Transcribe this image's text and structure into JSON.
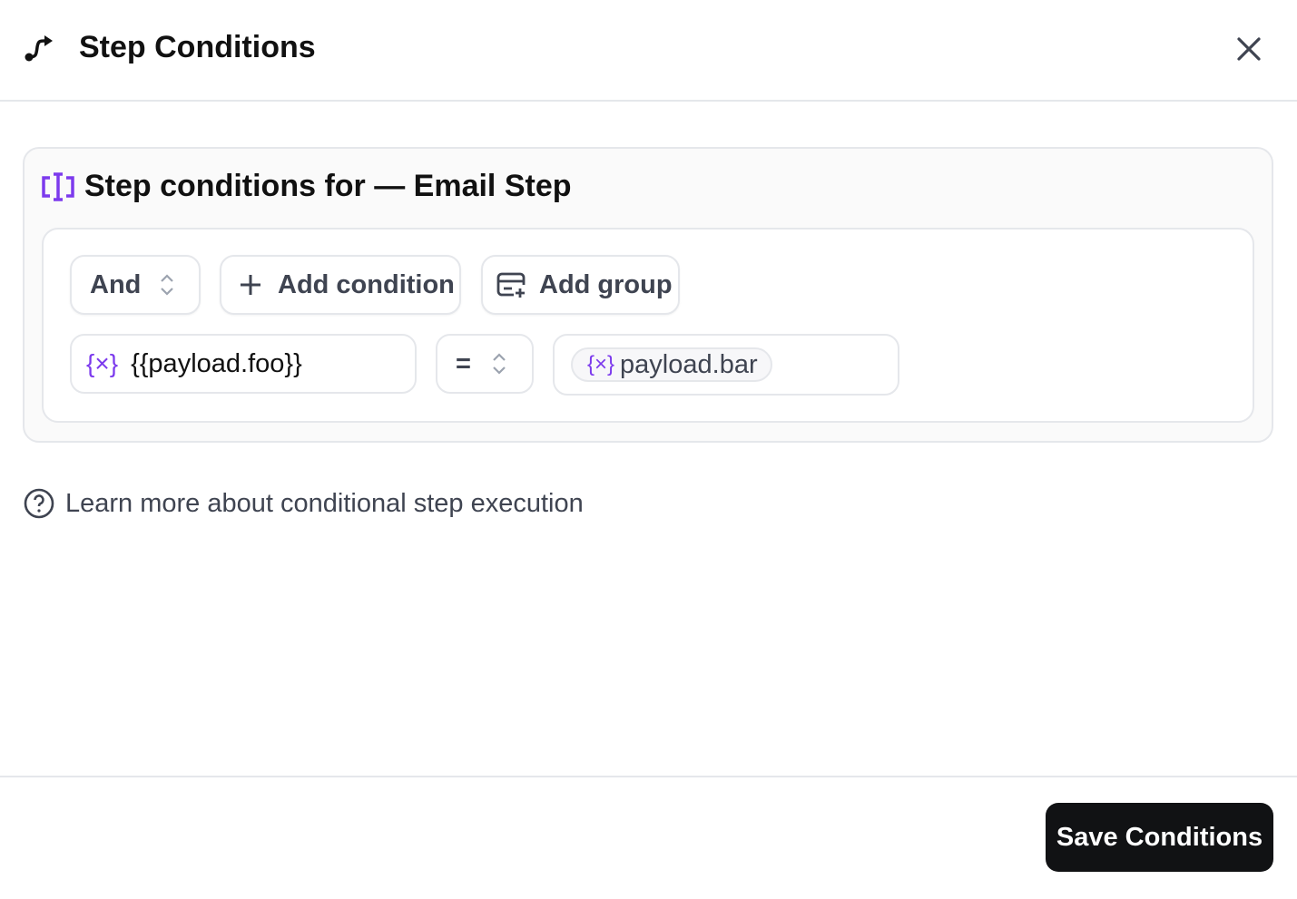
{
  "header": {
    "title": "Step Conditions",
    "icon": "route-icon",
    "close_icon": "close-icon"
  },
  "card": {
    "title": "Step conditions for — Email Step",
    "icon": "text-cursor-input-icon",
    "accent": "#7c3aed"
  },
  "toolbar": {
    "combinator": "And",
    "add_condition": "Add condition",
    "add_group": "Add group"
  },
  "condition": {
    "field": "{{payload.foo}}",
    "operator": "=",
    "value": "payload.bar"
  },
  "learn_more": "Learn more about conditional step execution",
  "footer": {
    "save_label": "Save Conditions"
  }
}
